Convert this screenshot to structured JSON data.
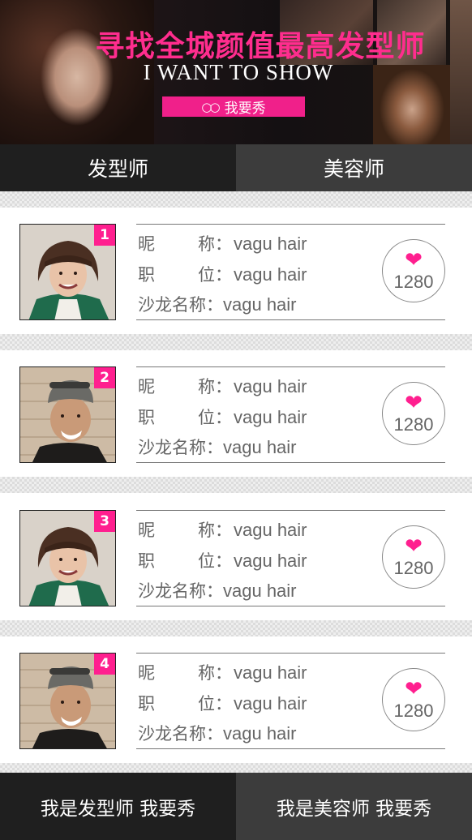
{
  "banner": {
    "title": "寻找全城颜值最高发型师",
    "subtitle": "I WANT TO SHOW",
    "button_label": "我要秀",
    "button_icon": "infinity-icon",
    "accent_color": "#f0208a"
  },
  "tabs": [
    {
      "label": "发型师",
      "active": true
    },
    {
      "label": "美容师",
      "active": false
    }
  ],
  "labels": {
    "nickname_a": "昵",
    "nickname_b": "称：",
    "position_a": "职",
    "position_b": "位：",
    "salon": "沙龙名称："
  },
  "stylists": [
    {
      "rank": "1",
      "nickname": "vagu hair",
      "position": "vagu hair",
      "salon": "vagu hair",
      "likes": "1280",
      "avatar": "woman-bob-hair"
    },
    {
      "rank": "2",
      "nickname": "vagu hair",
      "position": "vagu hair",
      "salon": "vagu hair",
      "likes": "1280",
      "avatar": "man-beanie-glasses"
    },
    {
      "rank": "3",
      "nickname": "vagu hair",
      "position": "vagu hair",
      "salon": "vagu hair",
      "likes": "1280",
      "avatar": "woman-bob-hair"
    },
    {
      "rank": "4",
      "nickname": "vagu hair",
      "position": "vagu hair",
      "salon": "vagu hair",
      "likes": "1280",
      "avatar": "man-beanie-glasses"
    }
  ],
  "like_icon": "heart-icon",
  "bottom": {
    "left_label": "我是发型师 我要秀",
    "right_label": "我是美容师 我要秀"
  }
}
